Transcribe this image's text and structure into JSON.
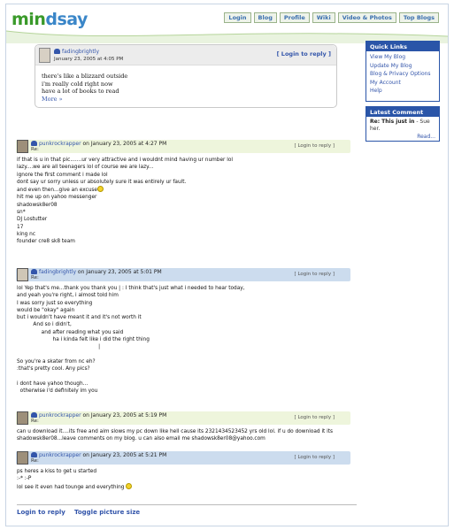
{
  "brand": {
    "part1": "mi",
    "part2": "n",
    "part3": "dsay"
  },
  "nav": [
    {
      "label": "Login"
    },
    {
      "label": "Blog"
    },
    {
      "label": "Profile"
    },
    {
      "label": "Wiki"
    },
    {
      "label": "Video & Photos"
    },
    {
      "label": "Top Blogs"
    }
  ],
  "parent": {
    "user": "fadingbrightly",
    "date": "January 23, 2005 at 4:05 PM",
    "reply": "[ Login to reply ]",
    "lines": [
      "there's like a blizzard outside",
      "i'm really cold right now",
      "have a lot of books to read"
    ],
    "more": "More »"
  },
  "comments": [
    {
      "user": "punkrockrapper",
      "when": "on January 23, 2005 at 4:27 PM",
      "re": "Re:",
      "reply": "[ Login to reply ]",
      "lines": [
        "if that is u in that pic.......ur very attractive and i wouldnt mind having ur number lol",
        "lazy....we are all teenagers lol of course we are lazy...",
        "ignore the first comment i made lol",
        "dont say ur sorry unless ur absolutely sure it was entirely ur fault.",
        "and even then...give an excuse",
        "hit me up on yahoo messenger",
        "shadowsk8er08",
        "sn*",
        "DJ Lostutter",
        "17",
        "king nc",
        "founder cre8 sk8 team"
      ]
    },
    {
      "user": "fadingbrightly",
      "when": "on January 23, 2005 at 5:01 PM",
      "re": "Re:",
      "reply": "[ Login to reply ]",
      "lines": [
        "lol Yep that's me...thank you thank you | : I think that's just what i needed to hear today,",
        "and yeah you're right, i almost told him",
        "I was sorry just so everything",
        "would be \"okay\" again",
        "but i wouldn't have meant it and it's not worth it",
        "          And so i didn't,",
        "               and after reading what you said",
        "                      ha i kinda felt like i did the right thing",
        "                                                  |",
        "",
        "So you're a skater from nc eh?",
        ":that's pretty cool. Any pics?",
        "",
        "i dont have yahoo though...",
        "  otherwise i'd definitely im you"
      ]
    },
    {
      "user": "punkrockrapper",
      "when": "on January 23, 2005 at 5:19 PM",
      "re": "Re:",
      "reply": "[ Login to reply ]",
      "lines": [
        "can u download it....its free and aim slows my pc down like hell cause its 2321434523452 yrs old lol. if u do download it its",
        "shadowsk8er08...leave comments on my blog. u can also email me shadowsk8er08@yahoo.com"
      ]
    },
    {
      "user": "punkrockrapper",
      "when": "on January 23, 2005 at 5:21 PM",
      "re": "Re:",
      "reply": "[ Login to reply ]",
      "lines": [
        "ps heres a kiss to get u started",
        ":-* :-P",
        "lol see it even had tounge and everything"
      ]
    }
  ],
  "sidebar": {
    "quick_title": "Quick Links",
    "quick_links": [
      "View My Blog",
      "Update My Blog",
      "Blog & Privacy Options",
      "My Account",
      "Help"
    ],
    "latest_title": "Latest Comment",
    "latest_re": "Re: This just in",
    "latest_by": " - Sue her.",
    "latest_read": "Read..."
  },
  "bottom": {
    "login": "Login to reply",
    "toggle": "Toggle picture size"
  }
}
